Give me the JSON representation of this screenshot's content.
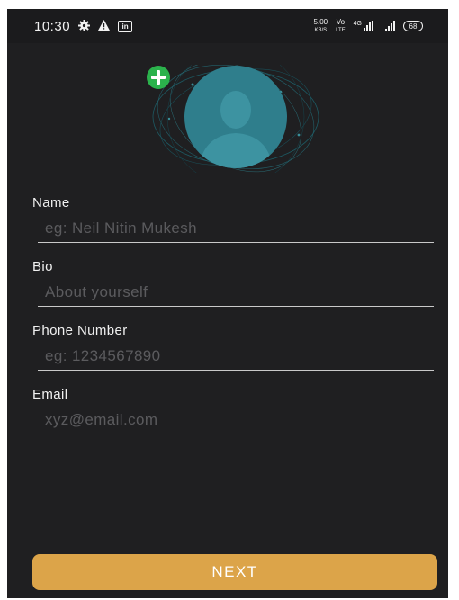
{
  "status_bar": {
    "time": "10:30",
    "icons": [
      "settings-icon",
      "warning-icon",
      "linkedin-icon"
    ],
    "linkedin_text": "in",
    "net_speed": "5.00",
    "net_unit": "KB/S",
    "volte_top": "Vo",
    "volte_bottom": "LTE",
    "network_type": "4G",
    "battery": "68"
  },
  "profile": {
    "avatar": "user-silhouette-icon",
    "add_photo": "plus-icon",
    "accent_color": "#2bb24c",
    "avatar_color": "#2f7e8c"
  },
  "form": {
    "name": {
      "label": "Name",
      "placeholder": "eg: Neil Nitin Mukesh",
      "value": ""
    },
    "bio": {
      "label": "Bio",
      "placeholder": "About yourself",
      "value": ""
    },
    "phone": {
      "label": "Phone Number",
      "placeholder": "eg: 1234567890",
      "value": ""
    },
    "email": {
      "label": "Email",
      "placeholder": "xyz@email.com",
      "value": ""
    }
  },
  "actions": {
    "next_label": "NEXT",
    "next_color": "#dca449"
  }
}
